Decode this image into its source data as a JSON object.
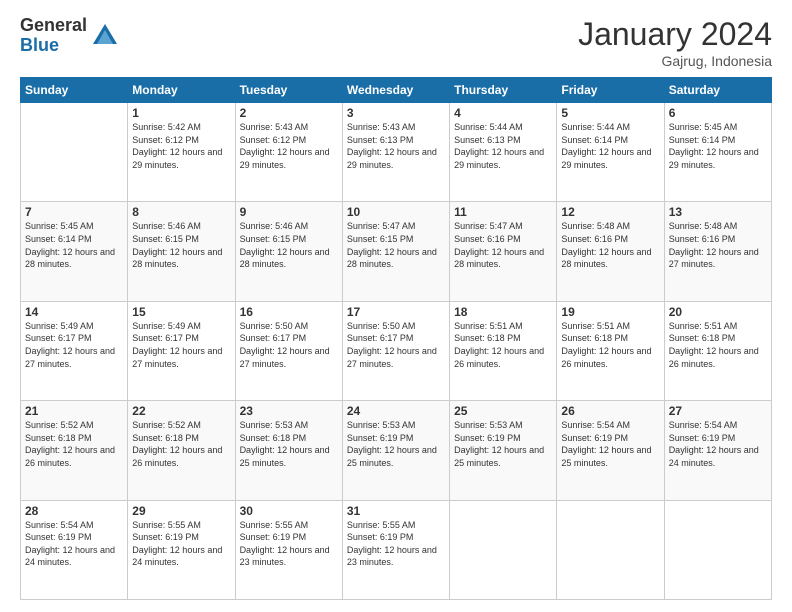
{
  "logo": {
    "general": "General",
    "blue": "Blue"
  },
  "header": {
    "title": "January 2024",
    "location": "Gajrug, Indonesia"
  },
  "weekdays": [
    "Sunday",
    "Monday",
    "Tuesday",
    "Wednesday",
    "Thursday",
    "Friday",
    "Saturday"
  ],
  "weeks": [
    [
      {
        "day": "",
        "sunrise": "",
        "sunset": "",
        "daylight": ""
      },
      {
        "day": "1",
        "sunrise": "Sunrise: 5:42 AM",
        "sunset": "Sunset: 6:12 PM",
        "daylight": "Daylight: 12 hours and 29 minutes."
      },
      {
        "day": "2",
        "sunrise": "Sunrise: 5:43 AM",
        "sunset": "Sunset: 6:12 PM",
        "daylight": "Daylight: 12 hours and 29 minutes."
      },
      {
        "day": "3",
        "sunrise": "Sunrise: 5:43 AM",
        "sunset": "Sunset: 6:13 PM",
        "daylight": "Daylight: 12 hours and 29 minutes."
      },
      {
        "day": "4",
        "sunrise": "Sunrise: 5:44 AM",
        "sunset": "Sunset: 6:13 PM",
        "daylight": "Daylight: 12 hours and 29 minutes."
      },
      {
        "day": "5",
        "sunrise": "Sunrise: 5:44 AM",
        "sunset": "Sunset: 6:14 PM",
        "daylight": "Daylight: 12 hours and 29 minutes."
      },
      {
        "day": "6",
        "sunrise": "Sunrise: 5:45 AM",
        "sunset": "Sunset: 6:14 PM",
        "daylight": "Daylight: 12 hours and 29 minutes."
      }
    ],
    [
      {
        "day": "7",
        "sunrise": "Sunrise: 5:45 AM",
        "sunset": "Sunset: 6:14 PM",
        "daylight": "Daylight: 12 hours and 28 minutes."
      },
      {
        "day": "8",
        "sunrise": "Sunrise: 5:46 AM",
        "sunset": "Sunset: 6:15 PM",
        "daylight": "Daylight: 12 hours and 28 minutes."
      },
      {
        "day": "9",
        "sunrise": "Sunrise: 5:46 AM",
        "sunset": "Sunset: 6:15 PM",
        "daylight": "Daylight: 12 hours and 28 minutes."
      },
      {
        "day": "10",
        "sunrise": "Sunrise: 5:47 AM",
        "sunset": "Sunset: 6:15 PM",
        "daylight": "Daylight: 12 hours and 28 minutes."
      },
      {
        "day": "11",
        "sunrise": "Sunrise: 5:47 AM",
        "sunset": "Sunset: 6:16 PM",
        "daylight": "Daylight: 12 hours and 28 minutes."
      },
      {
        "day": "12",
        "sunrise": "Sunrise: 5:48 AM",
        "sunset": "Sunset: 6:16 PM",
        "daylight": "Daylight: 12 hours and 28 minutes."
      },
      {
        "day": "13",
        "sunrise": "Sunrise: 5:48 AM",
        "sunset": "Sunset: 6:16 PM",
        "daylight": "Daylight: 12 hours and 27 minutes."
      }
    ],
    [
      {
        "day": "14",
        "sunrise": "Sunrise: 5:49 AM",
        "sunset": "Sunset: 6:17 PM",
        "daylight": "Daylight: 12 hours and 27 minutes."
      },
      {
        "day": "15",
        "sunrise": "Sunrise: 5:49 AM",
        "sunset": "Sunset: 6:17 PM",
        "daylight": "Daylight: 12 hours and 27 minutes."
      },
      {
        "day": "16",
        "sunrise": "Sunrise: 5:50 AM",
        "sunset": "Sunset: 6:17 PM",
        "daylight": "Daylight: 12 hours and 27 minutes."
      },
      {
        "day": "17",
        "sunrise": "Sunrise: 5:50 AM",
        "sunset": "Sunset: 6:17 PM",
        "daylight": "Daylight: 12 hours and 27 minutes."
      },
      {
        "day": "18",
        "sunrise": "Sunrise: 5:51 AM",
        "sunset": "Sunset: 6:18 PM",
        "daylight": "Daylight: 12 hours and 26 minutes."
      },
      {
        "day": "19",
        "sunrise": "Sunrise: 5:51 AM",
        "sunset": "Sunset: 6:18 PM",
        "daylight": "Daylight: 12 hours and 26 minutes."
      },
      {
        "day": "20",
        "sunrise": "Sunrise: 5:51 AM",
        "sunset": "Sunset: 6:18 PM",
        "daylight": "Daylight: 12 hours and 26 minutes."
      }
    ],
    [
      {
        "day": "21",
        "sunrise": "Sunrise: 5:52 AM",
        "sunset": "Sunset: 6:18 PM",
        "daylight": "Daylight: 12 hours and 26 minutes."
      },
      {
        "day": "22",
        "sunrise": "Sunrise: 5:52 AM",
        "sunset": "Sunset: 6:18 PM",
        "daylight": "Daylight: 12 hours and 26 minutes."
      },
      {
        "day": "23",
        "sunrise": "Sunrise: 5:53 AM",
        "sunset": "Sunset: 6:18 PM",
        "daylight": "Daylight: 12 hours and 25 minutes."
      },
      {
        "day": "24",
        "sunrise": "Sunrise: 5:53 AM",
        "sunset": "Sunset: 6:19 PM",
        "daylight": "Daylight: 12 hours and 25 minutes."
      },
      {
        "day": "25",
        "sunrise": "Sunrise: 5:53 AM",
        "sunset": "Sunset: 6:19 PM",
        "daylight": "Daylight: 12 hours and 25 minutes."
      },
      {
        "day": "26",
        "sunrise": "Sunrise: 5:54 AM",
        "sunset": "Sunset: 6:19 PM",
        "daylight": "Daylight: 12 hours and 25 minutes."
      },
      {
        "day": "27",
        "sunrise": "Sunrise: 5:54 AM",
        "sunset": "Sunset: 6:19 PM",
        "daylight": "Daylight: 12 hours and 24 minutes."
      }
    ],
    [
      {
        "day": "28",
        "sunrise": "Sunrise: 5:54 AM",
        "sunset": "Sunset: 6:19 PM",
        "daylight": "Daylight: 12 hours and 24 minutes."
      },
      {
        "day": "29",
        "sunrise": "Sunrise: 5:55 AM",
        "sunset": "Sunset: 6:19 PM",
        "daylight": "Daylight: 12 hours and 24 minutes."
      },
      {
        "day": "30",
        "sunrise": "Sunrise: 5:55 AM",
        "sunset": "Sunset: 6:19 PM",
        "daylight": "Daylight: 12 hours and 23 minutes."
      },
      {
        "day": "31",
        "sunrise": "Sunrise: 5:55 AM",
        "sunset": "Sunset: 6:19 PM",
        "daylight": "Daylight: 12 hours and 23 minutes."
      },
      {
        "day": "",
        "sunrise": "",
        "sunset": "",
        "daylight": ""
      },
      {
        "day": "",
        "sunrise": "",
        "sunset": "",
        "daylight": ""
      },
      {
        "day": "",
        "sunrise": "",
        "sunset": "",
        "daylight": ""
      }
    ]
  ]
}
